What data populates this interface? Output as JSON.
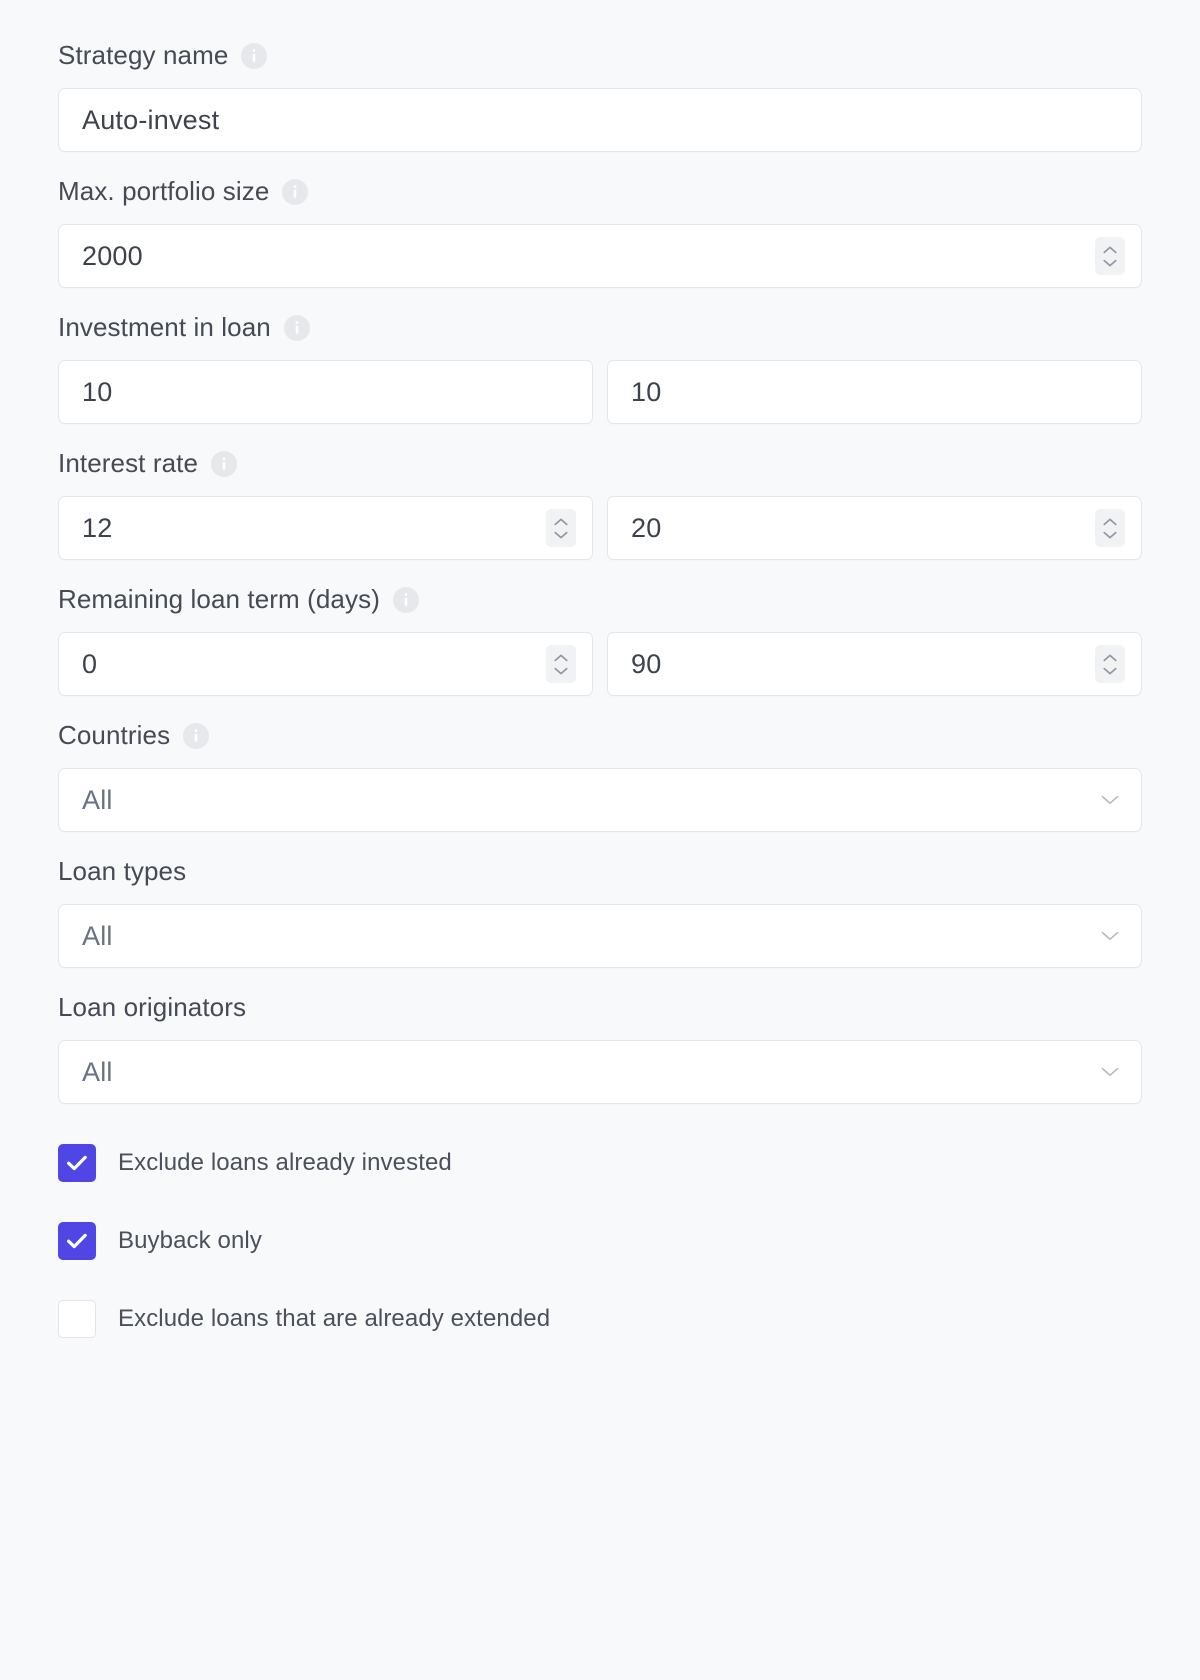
{
  "theme": {
    "page_bg": "#f8f9fa",
    "field_bg": "#ffffff",
    "border": "#e4e6ea",
    "label_color": "#454a54",
    "value_color": "#3d424c",
    "checkbox_accent": "#4f46e5",
    "info_icon_bg": "#e6e8ec"
  },
  "form": {
    "fields": [
      {
        "id": "strategy-name",
        "label": "Strategy name",
        "has_info_icon": true,
        "control": "text",
        "inputs": [
          {
            "value": "Auto-invest",
            "stepper": false
          }
        ]
      },
      {
        "id": "max-portfolio-size",
        "label": "Max. portfolio size",
        "has_info_icon": true,
        "control": "number",
        "inputs": [
          {
            "value": "2000",
            "stepper": true
          }
        ]
      },
      {
        "id": "investment-in-loan",
        "label": "Investment in loan",
        "has_info_icon": true,
        "control": "range",
        "inputs": [
          {
            "value": "10",
            "stepper": false
          },
          {
            "value": "10",
            "stepper": false
          }
        ]
      },
      {
        "id": "interest-rate",
        "label": "Interest rate",
        "has_info_icon": true,
        "control": "range",
        "inputs": [
          {
            "value": "12",
            "stepper": true
          },
          {
            "value": "20",
            "stepper": true
          }
        ]
      },
      {
        "id": "remaining-loan-term",
        "label": "Remaining loan term (days)",
        "has_info_icon": true,
        "control": "range",
        "inputs": [
          {
            "value": "0",
            "stepper": true
          },
          {
            "value": "90",
            "stepper": true
          }
        ]
      },
      {
        "id": "countries",
        "label": "Countries",
        "has_info_icon": true,
        "control": "select",
        "inputs": [
          {
            "value": "All",
            "stepper": false
          }
        ]
      },
      {
        "id": "loan-types",
        "label": "Loan types",
        "has_info_icon": false,
        "control": "select",
        "inputs": [
          {
            "value": "All",
            "stepper": false
          }
        ]
      },
      {
        "id": "loan-originators",
        "label": "Loan originators",
        "has_info_icon": false,
        "control": "select",
        "inputs": [
          {
            "value": "All",
            "stepper": false
          }
        ]
      }
    ],
    "checkboxes": [
      {
        "id": "exclude-loans-already-invested",
        "label": "Exclude loans already invested",
        "checked": true
      },
      {
        "id": "buyback-only",
        "label": "Buyback only",
        "checked": true
      },
      {
        "id": "exclude-loans-already-extended",
        "label": "Exclude loans that are already extended",
        "checked": false
      }
    ]
  },
  "icons": {
    "info": "info-icon",
    "stepper_up": "chevron-up-icon",
    "stepper_down": "chevron-down-icon",
    "select_caret": "caret-down-icon",
    "check": "check-icon"
  }
}
